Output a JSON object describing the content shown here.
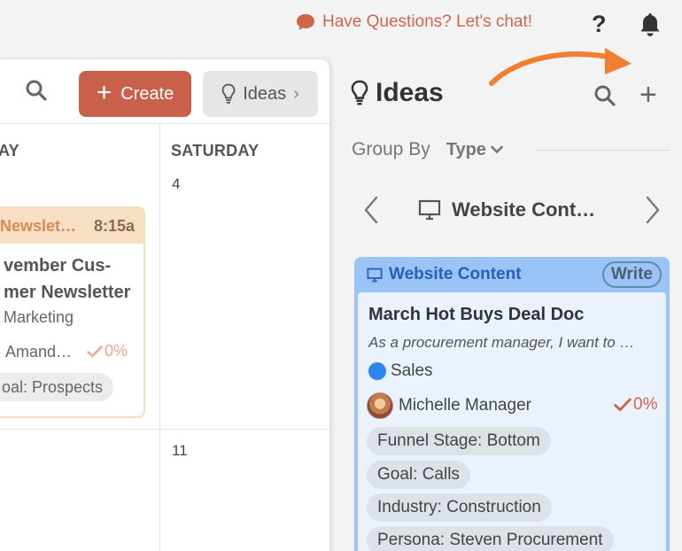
{
  "topbar": {
    "chat_label": "Have Questions? Let's chat!",
    "help_label": "?",
    "icons": [
      "chat-bubble-icon",
      "help-icon",
      "bell-icon"
    ]
  },
  "calendar": {
    "create_label": "Create",
    "ideas_label": "Ideas",
    "day_headers": [
      "AY",
      "SATURDAY"
    ],
    "day_numbers": [
      "4",
      "11"
    ],
    "event": {
      "name": "Newslet…",
      "time": "8:15a",
      "title_line1": "vember Cus-",
      "title_line2": "mer Newsletter",
      "category": "Marketing",
      "owner": "Amand…",
      "progress": "0%",
      "tag": "oal: Prospects"
    }
  },
  "ideas_panel": {
    "title": "Ideas",
    "group_by_label": "Group By",
    "group_by_value": "Type",
    "current_type": "Website Cont…",
    "card": {
      "type": "Website Content",
      "action": "Write",
      "title": "March Hot Buys Deal Doc",
      "description": "As a procurement manager, I want to …",
      "category": "Sales",
      "owner": "Michelle Manager",
      "progress": "0%",
      "tags": [
        "Funnel Stage: Bottom",
        "Goal: Calls",
        "Industry: Construction",
        "Persona: Steven Procurement"
      ]
    }
  },
  "colors": {
    "accent": "#c9604b",
    "chat_text": "#d0654b",
    "arrow": "#f08030",
    "card_header": "#9ac4f6",
    "card_body": "#eaf3fd",
    "category_sales": "#2b86f0"
  }
}
